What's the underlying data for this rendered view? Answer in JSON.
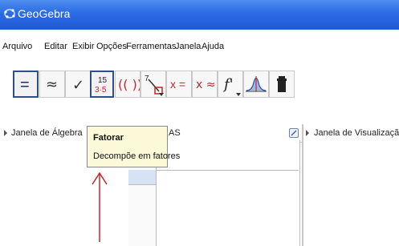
{
  "window": {
    "title": "GeoGebra"
  },
  "menu": [
    "Arquivo",
    "Editar",
    "Exibir",
    "Opções",
    "Ferramentas",
    "Janela",
    "Ajuda"
  ],
  "toolbar": {
    "buttons": [
      {
        "name": "equals-tool",
        "symbol": "="
      },
      {
        "name": "approx-tool",
        "symbol": "≈"
      },
      {
        "name": "check-tool",
        "symbol": "✓"
      },
      {
        "name": "factor-tool",
        "top": "15",
        "bottom": "3·5"
      },
      {
        "name": "parentheses-tool",
        "symbol": "(( ))"
      },
      {
        "name": "substitute-tool",
        "symbol": "7"
      },
      {
        "name": "solve-tool",
        "symbol": "x ="
      },
      {
        "name": "numeric-solve-tool",
        "symbol": "x ≈"
      },
      {
        "name": "derivative-tool",
        "symbol": "f'"
      },
      {
        "name": "probability-tool",
        "symbol": ""
      },
      {
        "name": "delete-tool",
        "symbol": ""
      }
    ]
  },
  "panels": {
    "algebra": "Janela de Álgebra",
    "cas_fragment": "AS",
    "graphics": "Janela de Visualização"
  },
  "tooltip": {
    "title": "Fatorar",
    "description": "Decompõe em fatores"
  },
  "colors": {
    "title_bar": "#2d6ee6",
    "tooltip_bg": "#fbf9d8",
    "arrow": "#c0282d",
    "active_border": "#2f4d8a"
  }
}
